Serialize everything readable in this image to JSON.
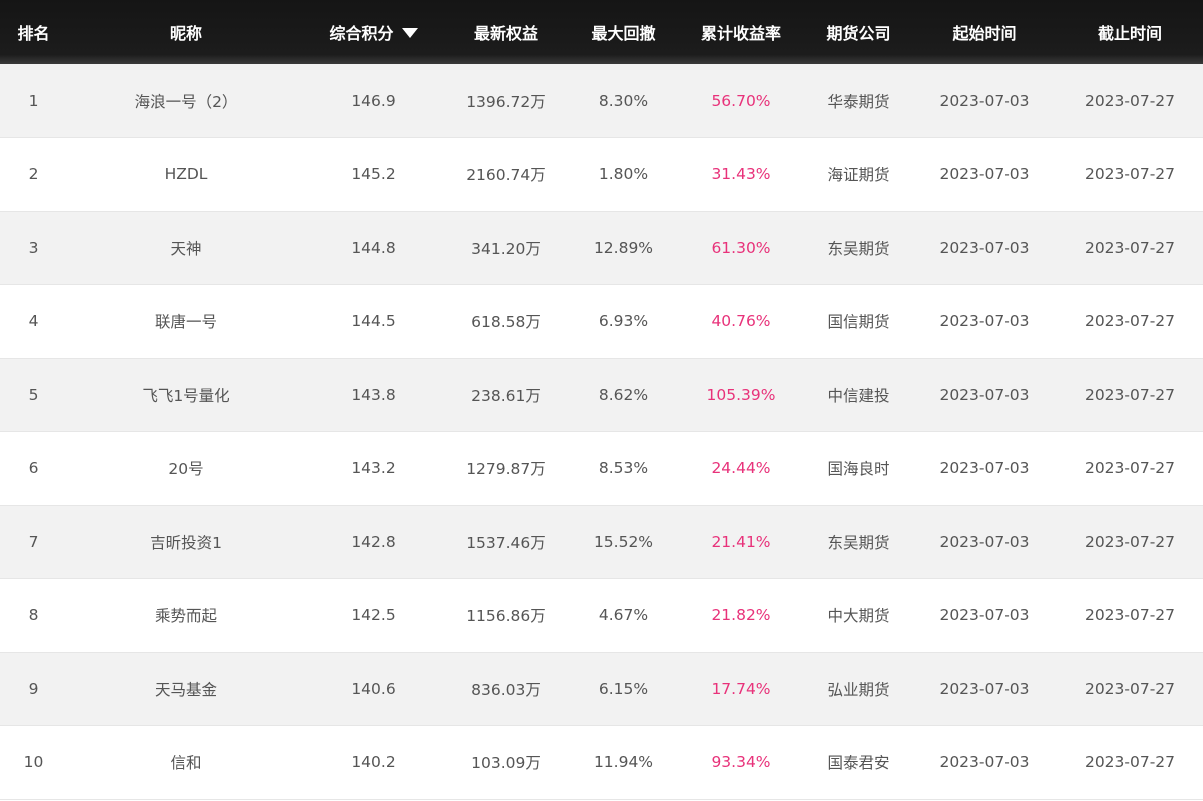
{
  "headers": {
    "rank": "排名",
    "nickname": "昵称",
    "score": "综合积分",
    "equity": "最新权益",
    "drawdown": "最大回撤",
    "return_rate": "累计收益率",
    "broker": "期货公司",
    "start": "起始时间",
    "end": "截止时间"
  },
  "sort": {
    "column": "score",
    "direction": "desc",
    "icon": "triangle-down-icon"
  },
  "colors": {
    "header_bg": "#1a1a1a",
    "return_rate": "#e8327a",
    "row_alt": "#f2f2f2"
  },
  "rows": [
    {
      "rank": "1",
      "nickname": "海浪一号（2）",
      "score": "146.9",
      "equity": "1396.72万",
      "drawdown": "8.30%",
      "return_rate": "56.70%",
      "broker": "华泰期货",
      "start": "2023-07-03",
      "end": "2023-07-27"
    },
    {
      "rank": "2",
      "nickname": "HZDL",
      "score": "145.2",
      "equity": "2160.74万",
      "drawdown": "1.80%",
      "return_rate": "31.43%",
      "broker": "海证期货",
      "start": "2023-07-03",
      "end": "2023-07-27"
    },
    {
      "rank": "3",
      "nickname": "天神",
      "score": "144.8",
      "equity": "341.20万",
      "drawdown": "12.89%",
      "return_rate": "61.30%",
      "broker": "东吴期货",
      "start": "2023-07-03",
      "end": "2023-07-27"
    },
    {
      "rank": "4",
      "nickname": "联唐一号",
      "score": "144.5",
      "equity": "618.58万",
      "drawdown": "6.93%",
      "return_rate": "40.76%",
      "broker": "国信期货",
      "start": "2023-07-03",
      "end": "2023-07-27"
    },
    {
      "rank": "5",
      "nickname": "飞飞1号量化",
      "score": "143.8",
      "equity": "238.61万",
      "drawdown": "8.62%",
      "return_rate": "105.39%",
      "broker": "中信建投",
      "start": "2023-07-03",
      "end": "2023-07-27"
    },
    {
      "rank": "6",
      "nickname": "20号",
      "score": "143.2",
      "equity": "1279.87万",
      "drawdown": "8.53%",
      "return_rate": "24.44%",
      "broker": "国海良时",
      "start": "2023-07-03",
      "end": "2023-07-27"
    },
    {
      "rank": "7",
      "nickname": "吉昕投资1",
      "score": "142.8",
      "equity": "1537.46万",
      "drawdown": "15.52%",
      "return_rate": "21.41%",
      "broker": "东吴期货",
      "start": "2023-07-03",
      "end": "2023-07-27"
    },
    {
      "rank": "8",
      "nickname": "乘势而起",
      "score": "142.5",
      "equity": "1156.86万",
      "drawdown": "4.67%",
      "return_rate": "21.82%",
      "broker": "中大期货",
      "start": "2023-07-03",
      "end": "2023-07-27"
    },
    {
      "rank": "9",
      "nickname": "天马基金",
      "score": "140.6",
      "equity": "836.03万",
      "drawdown": "6.15%",
      "return_rate": "17.74%",
      "broker": "弘业期货",
      "start": "2023-07-03",
      "end": "2023-07-27"
    },
    {
      "rank": "10",
      "nickname": "信和",
      "score": "140.2",
      "equity": "103.09万",
      "drawdown": "11.94%",
      "return_rate": "93.34%",
      "broker": "国泰君安",
      "start": "2023-07-03",
      "end": "2023-07-27"
    }
  ]
}
